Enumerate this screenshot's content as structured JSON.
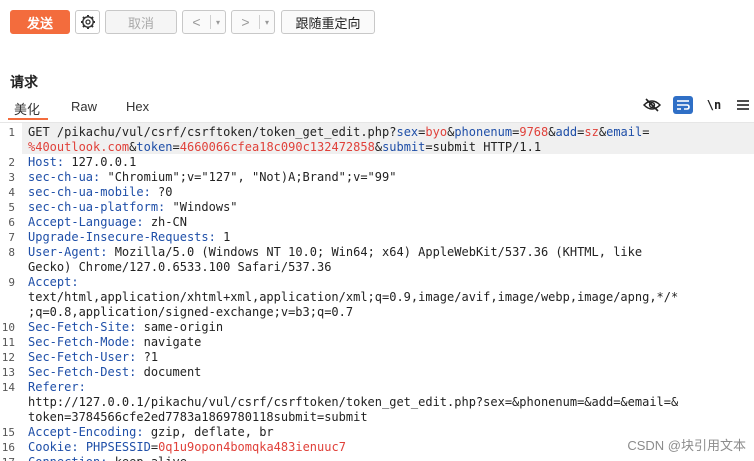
{
  "toolbar": {
    "send_label": "发送",
    "cancel_label": "取消",
    "back_label": "<",
    "forward_label": ">",
    "dropdown_glyph": "▾",
    "follow_redirect_label": "跟随重定向"
  },
  "panel": {
    "title": "请求",
    "tabs": [
      "美化",
      "Raw",
      "Hex"
    ],
    "active_tab": "美化",
    "icons": [
      "eye-off-icon",
      "wrap-icon",
      "newline-icon",
      "menu-icon"
    ],
    "newline_label": "\\n"
  },
  "editor": {
    "lines": [
      {
        "n": "1",
        "segments": [
          {
            "t": "GET /pikachu/vul/csrf/csrftoken/token_get_edit.php?",
            "c": ""
          },
          {
            "t": "sex",
            "c": "k"
          },
          {
            "t": "=",
            "c": ""
          },
          {
            "t": "byo",
            "c": "pv"
          },
          {
            "t": "&",
            "c": ""
          },
          {
            "t": "phonenum",
            "c": "k"
          },
          {
            "t": "=",
            "c": ""
          },
          {
            "t": "9768",
            "c": "pv"
          },
          {
            "t": "&",
            "c": ""
          },
          {
            "t": "add",
            "c": "k"
          },
          {
            "t": "=",
            "c": ""
          },
          {
            "t": "sz",
            "c": "pv"
          },
          {
            "t": "&",
            "c": ""
          },
          {
            "t": "email",
            "c": "k"
          },
          {
            "t": "=",
            "c": ""
          }
        ]
      },
      {
        "n": "",
        "segments": [
          {
            "t": "%40outlook.com",
            "c": "pv"
          },
          {
            "t": "&",
            "c": ""
          },
          {
            "t": "token",
            "c": "k"
          },
          {
            "t": "=",
            "c": ""
          },
          {
            "t": "4660066cfea18c090c132472858",
            "c": "pv"
          },
          {
            "t": "&",
            "c": ""
          },
          {
            "t": "submit",
            "c": "k"
          },
          {
            "t": "=",
            "c": ""
          },
          {
            "t": "submit",
            "c": ""
          },
          {
            "t": " HTTP/1.1",
            "c": ""
          }
        ]
      },
      {
        "n": "2",
        "segments": [
          {
            "t": "Host:",
            "c": "k"
          },
          {
            "t": " 127.0.0.1",
            "c": ""
          }
        ]
      },
      {
        "n": "3",
        "segments": [
          {
            "t": "sec-ch-ua:",
            "c": "k"
          },
          {
            "t": " \"Chromium\";v=\"127\", \"Not)A;Brand\";v=\"99\"",
            "c": ""
          }
        ]
      },
      {
        "n": "4",
        "segments": [
          {
            "t": "sec-ch-ua-mobile:",
            "c": "k"
          },
          {
            "t": " ?0",
            "c": ""
          }
        ]
      },
      {
        "n": "5",
        "segments": [
          {
            "t": "sec-ch-ua-platform:",
            "c": "k"
          },
          {
            "t": " \"Windows\"",
            "c": ""
          }
        ]
      },
      {
        "n": "6",
        "segments": [
          {
            "t": "Accept-Language:",
            "c": "k"
          },
          {
            "t": " zh-CN",
            "c": ""
          }
        ]
      },
      {
        "n": "7",
        "segments": [
          {
            "t": "Upgrade-Insecure-Requests:",
            "c": "k"
          },
          {
            "t": " 1",
            "c": ""
          }
        ]
      },
      {
        "n": "8",
        "segments": [
          {
            "t": "User-Agent:",
            "c": "k"
          },
          {
            "t": " Mozilla/5.0 (Windows NT 10.0; Win64; x64) AppleWebKit/537.36 (KHTML, like",
            "c": ""
          }
        ]
      },
      {
        "n": "",
        "segments": [
          {
            "t": "Gecko) Chrome/127.0.6533.100 Safari/537.36",
            "c": ""
          }
        ]
      },
      {
        "n": "9",
        "segments": [
          {
            "t": "Accept:",
            "c": "k"
          }
        ]
      },
      {
        "n": "",
        "segments": [
          {
            "t": "text/html,application/xhtml+xml,application/xml;q=0.9,image/avif,image/webp,image/apng,*/*",
            "c": ""
          }
        ]
      },
      {
        "n": "",
        "segments": [
          {
            "t": ";q=0.8,application/signed-exchange;v=b3;q=0.7",
            "c": ""
          }
        ]
      },
      {
        "n": "10",
        "segments": [
          {
            "t": "Sec-Fetch-Site:",
            "c": "k"
          },
          {
            "t": " same-origin",
            "c": ""
          }
        ]
      },
      {
        "n": "11",
        "segments": [
          {
            "t": "Sec-Fetch-Mode:",
            "c": "k"
          },
          {
            "t": " navigate",
            "c": ""
          }
        ]
      },
      {
        "n": "12",
        "segments": [
          {
            "t": "Sec-Fetch-User:",
            "c": "k"
          },
          {
            "t": " ?1",
            "c": ""
          }
        ]
      },
      {
        "n": "13",
        "segments": [
          {
            "t": "Sec-Fetch-Dest:",
            "c": "k"
          },
          {
            "t": " document",
            "c": ""
          }
        ]
      },
      {
        "n": "14",
        "segments": [
          {
            "t": "Referer:",
            "c": "k"
          }
        ]
      },
      {
        "n": "",
        "segments": [
          {
            "t": "http://127.0.0.1/pikachu/vul/csrf/csrftoken/token_get_edit.php?sex=&phonenum=&add=&email=&",
            "c": ""
          }
        ]
      },
      {
        "n": "",
        "segments": [
          {
            "t": "token=3784566cfe2ed7783a1869780118submit=submit",
            "c": ""
          }
        ]
      },
      {
        "n": "15",
        "segments": [
          {
            "t": "Accept-Encoding:",
            "c": "k"
          },
          {
            "t": " gzip, deflate, br",
            "c": ""
          }
        ]
      },
      {
        "n": "16",
        "segments": [
          {
            "t": "Cookie:",
            "c": "k"
          },
          {
            "t": " ",
            "c": ""
          },
          {
            "t": "PHPSESSID",
            "c": "k"
          },
          {
            "t": "=",
            "c": ""
          },
          {
            "t": "0q1u9opon4bomqka483ienuuc7",
            "c": "pv"
          }
        ]
      },
      {
        "n": "17",
        "segments": [
          {
            "t": "Connection:",
            "c": "k"
          },
          {
            "t": " keep-alive",
            "c": ""
          }
        ]
      }
    ]
  },
  "watermark": "CSDN @块引用文本"
}
